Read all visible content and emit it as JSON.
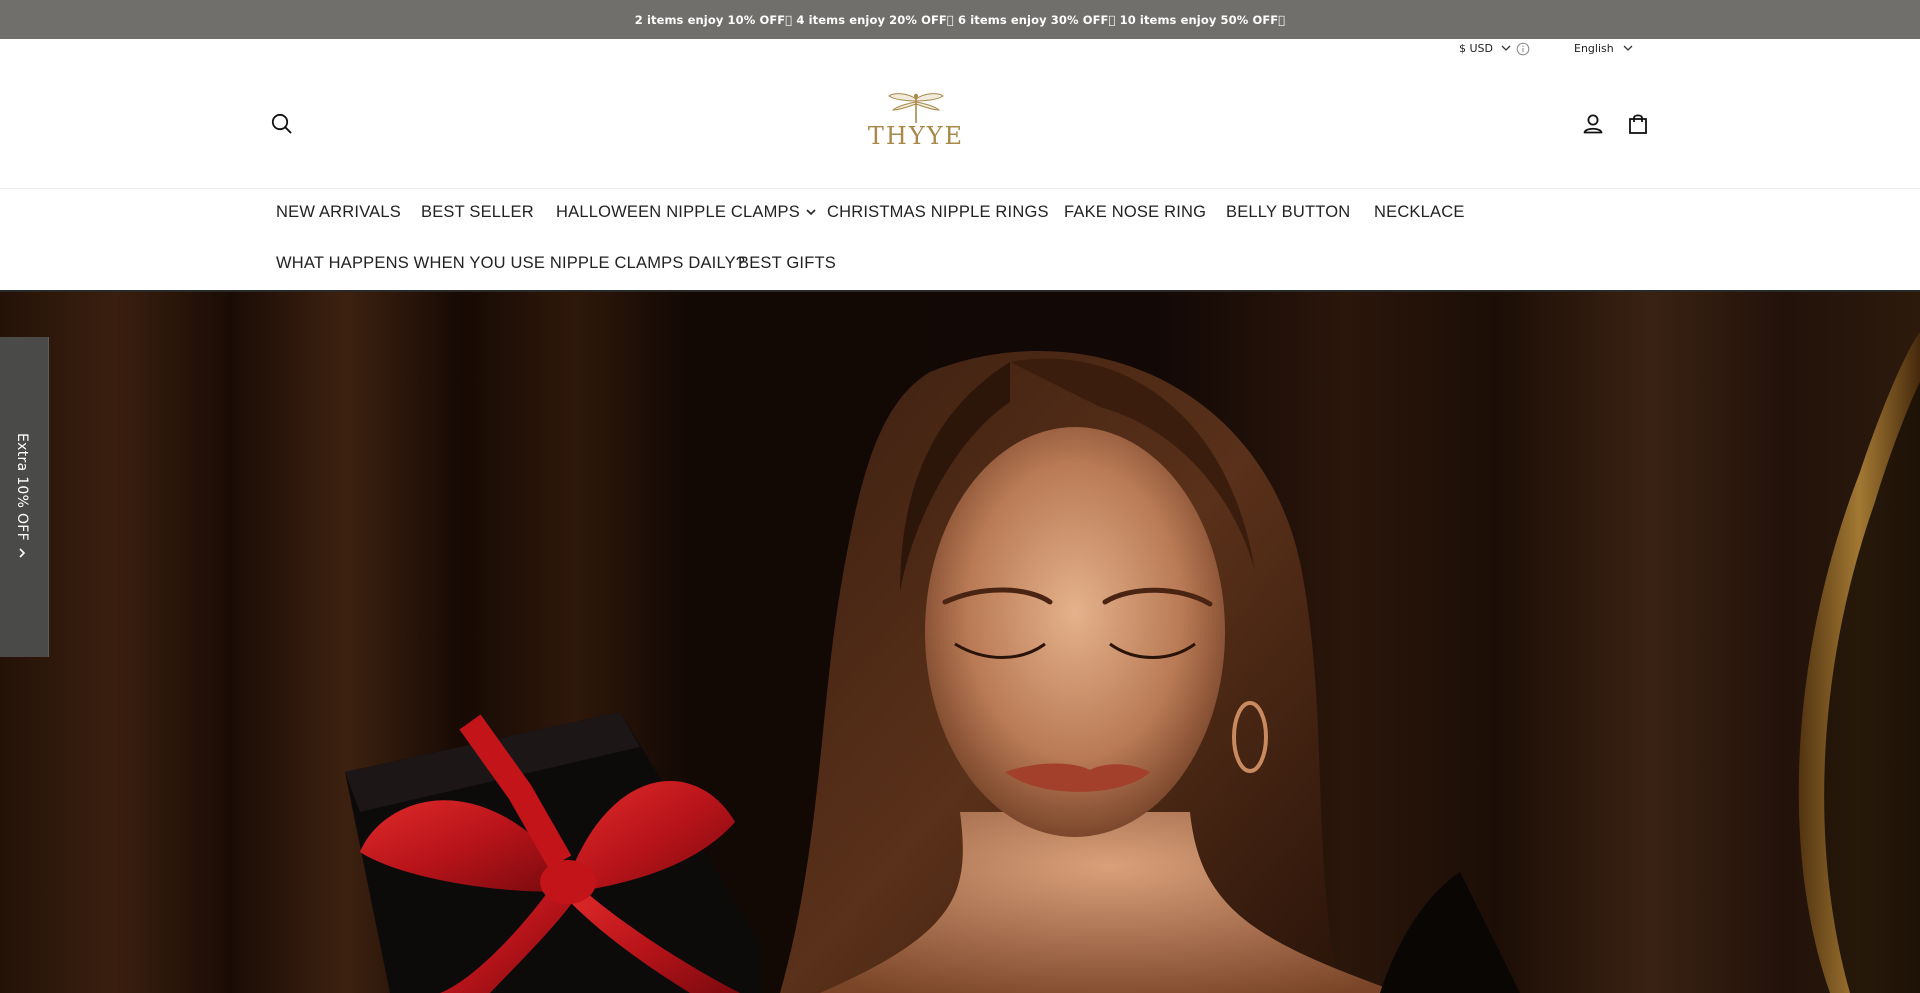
{
  "announcement": {
    "text": "2 items enjoy 10% OFF\u0000 4 items enjoy 20% OFF\u0000 6 items enjoy 30% OFF\u0000 10 items enjoy 50% OFF\u0000"
  },
  "utility": {
    "currency": "$ USD",
    "language": "English",
    "icons": [
      "chevron-down-icon",
      "info-icon"
    ]
  },
  "header": {
    "logo_text": "THYYE",
    "icons": [
      "search-icon",
      "dragonfly-logo",
      "account-icon",
      "shopping-bag-icon"
    ]
  },
  "nav": {
    "items": [
      {
        "label": "NEW ARRIVALS"
      },
      {
        "label": "BEST SELLER"
      },
      {
        "label": "HALLOWEEN NIPPLE CLAMPS",
        "has_dropdown": true
      },
      {
        "label": "CHRISTMAS NIPPLE RINGS"
      },
      {
        "label": "FAKE NOSE RING"
      },
      {
        "label": "BELLY BUTTON"
      },
      {
        "label": "NECKLACE"
      },
      {
        "label": "WHAT HAPPENS WHEN YOU USE NIPPLE CLAMPS DAILY?"
      },
      {
        "label": "BEST GIFTS"
      }
    ]
  },
  "side_tab": {
    "label": "Extra 10% OFF"
  },
  "colors": {
    "announcement_bg": "#716f6b",
    "logo_gold": "#a8894a",
    "side_tab_bg": "#4a4a48",
    "ribbon_red": "#c4161c"
  }
}
